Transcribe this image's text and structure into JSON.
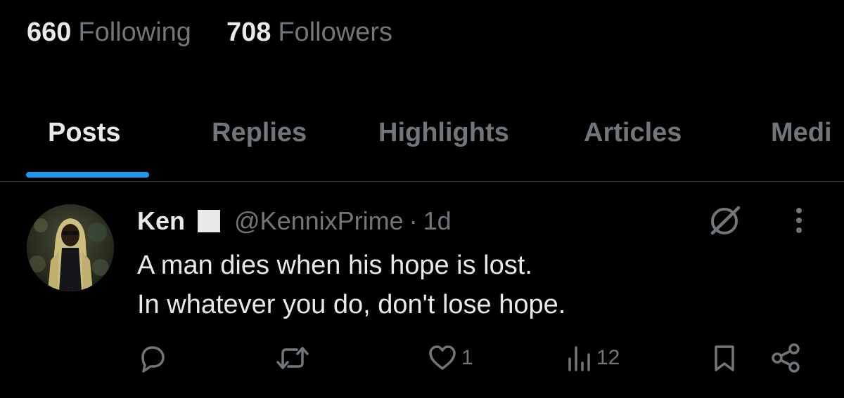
{
  "stats": {
    "following_count": "660",
    "following_label": "Following",
    "followers_count": "708",
    "followers_label": "Followers"
  },
  "tabs": [
    {
      "label": "Posts",
      "active": true
    },
    {
      "label": "Replies",
      "active": false
    },
    {
      "label": "Highlights",
      "active": false
    },
    {
      "label": "Articles",
      "active": false
    },
    {
      "label": "Medi",
      "active": false
    }
  ],
  "post": {
    "author_name": "Ken",
    "author_handle": "@KennixPrime",
    "separator": "·",
    "time": "1d",
    "text_lines": [
      "A man dies when his hope is lost.",
      "In whatever you do, don't lose hope."
    ],
    "actions": {
      "replies": "",
      "reposts": "",
      "likes": "1",
      "views": "12"
    },
    "icons": {
      "header_action": "grok-icon",
      "more": "more-icon",
      "reply": "reply-icon",
      "repost": "repost-icon",
      "like": "like-icon",
      "views": "views-icon",
      "bookmark": "bookmark-icon",
      "share": "share-icon"
    }
  },
  "colors": {
    "background": "#000000",
    "text_primary": "#e7e9ea",
    "text_secondary": "#71767b",
    "accent": "#1d9bf0",
    "divider": "#2f3336"
  }
}
